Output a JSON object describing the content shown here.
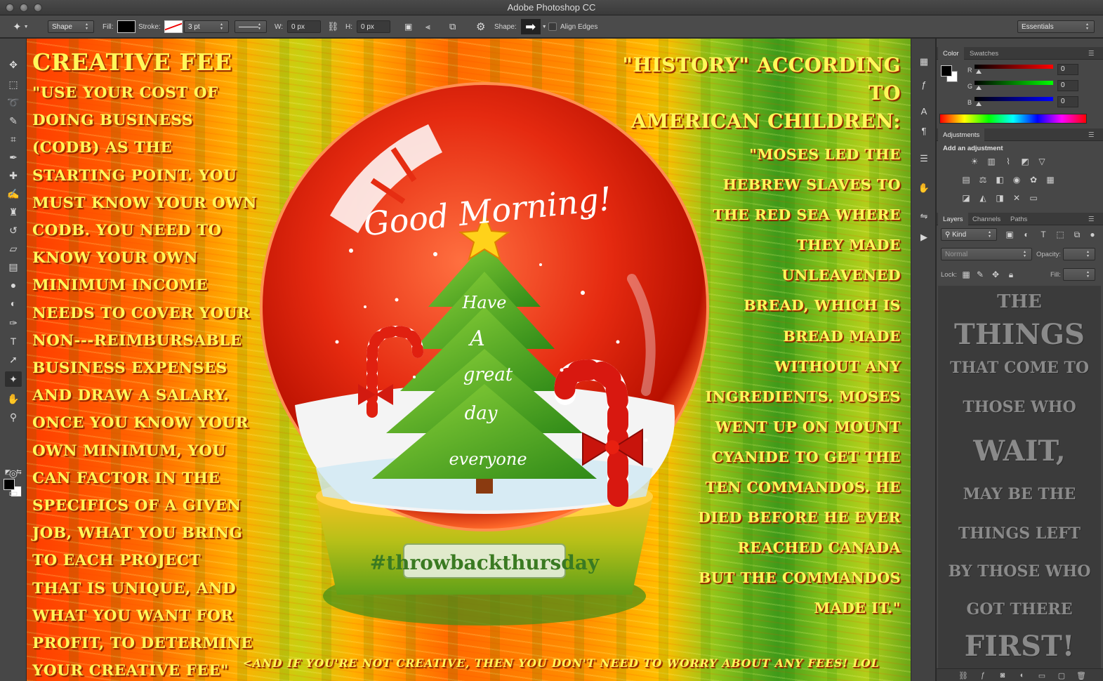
{
  "app": {
    "title": "Adobe Photoshop CC"
  },
  "options_bar": {
    "mode": "Shape",
    "fill_label": "Fill:",
    "stroke_label": "Stroke:",
    "stroke_width": "3 pt",
    "w_label": "W:",
    "w_value": "0 px",
    "h_label": "H:",
    "h_value": "0 px",
    "shape_label": "Shape:",
    "align_edges": "Align Edges",
    "workspace": "Essentials"
  },
  "canvas": {
    "left_title": "CREATIVE FEE",
    "left_body": [
      "\"USE YOUR COST OF",
      "DOING BUSINESS",
      "(CODB) AS THE",
      "STARTING POINT. YOU",
      "MUST KNOW YOUR OWN",
      "CODB. YOU NEED TO",
      "KNOW YOUR OWN",
      "MINIMUM INCOME",
      "NEEDS TO COVER YOUR",
      "NON---REIMBURSABLE",
      "BUSINESS EXPENSES",
      "AND DRAW A SALARY.",
      "ONCE YOU KNOW YOUR",
      "OWN MINIMUM, YOU",
      "CAN FACTOR IN THE",
      "SPECIFICS OF A GIVEN",
      "JOB, WHAT YOU BRING",
      "TO EACH PROJECT",
      "THAT IS UNIQUE, AND",
      "WHAT YOU WANT FOR",
      "PROFIT, TO DETERMINE",
      "YOUR CREATIVE FEE\""
    ],
    "right_title_1": "\"HISTORY\" ACCORDING TO",
    "right_title_2": "AMERICAN CHILDREN:",
    "right_body": [
      "\"MOSES LED THE",
      "HEBREW SLAVES TO",
      "THE RED SEA WHERE",
      "THEY MADE",
      "UNLEAVENED",
      "BREAD, WHICH IS",
      "BREAD MADE",
      "WITHOUT ANY",
      "INGREDIENTS. MOSES",
      "WENT UP ON MOUNT",
      "CYANIDE TO GET THE",
      "TEN COMMANDOS. HE",
      "DIED BEFORE HE EVER",
      "REACHED CANADA",
      "BUT THE COMMANDOS",
      "MADE IT.\""
    ],
    "bottom_note": "<AND IF YOU'RE NOT CREATIVE, THEN YOU DON'T NEED TO WORRY ABOUT ANY FEES! LOL",
    "globe": {
      "greeting": "Good Morning!",
      "tree_words": [
        "Have",
        "A",
        "great",
        "day",
        "everyone"
      ],
      "hashtag": "#throwbackthursday"
    }
  },
  "panels": {
    "color": {
      "tabs": [
        "Color",
        "Swatches"
      ],
      "channels": [
        {
          "label": "R",
          "value": "0"
        },
        {
          "label": "G",
          "value": "0"
        },
        {
          "label": "B",
          "value": "0"
        }
      ]
    },
    "adjustments": {
      "tab": "Adjustments",
      "hint": "Add an adjustment"
    },
    "layers": {
      "tabs": [
        "Layers",
        "Channels",
        "Paths"
      ],
      "filter": "Kind",
      "blend_mode": "Normal",
      "opacity_label": "Opacity:",
      "lock_label": "Lock:",
      "fill_label": "Fill:",
      "preview_lines": [
        "THE",
        "THINGS",
        "THAT COME TO",
        "THOSE WHO",
        "WAIT,",
        "MAY BE THE",
        "THINGS LEFT",
        "BY THOSE WHO",
        "GOT THERE",
        "FIRST!"
      ]
    }
  },
  "colors": {
    "foreground": "#000000",
    "background": "#ffffff",
    "text_yellow": "#fff85a"
  }
}
